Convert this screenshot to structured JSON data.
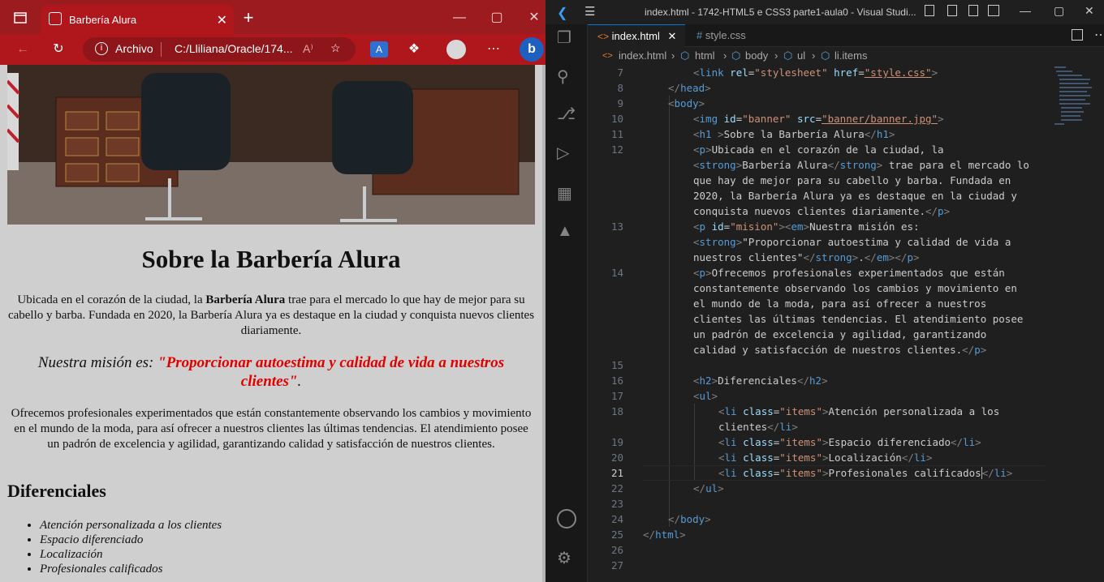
{
  "browser": {
    "tab_title": "Barbería Alura",
    "tab_close": "✕",
    "new_tab": "+",
    "window_controls": [
      "—",
      "▢",
      "✕"
    ],
    "address_label": "Archivo",
    "address_value": "C:/Lliliana/Oracle/174...",
    "reader": "A⁾",
    "icons": [
      "tabs-icon",
      "back-icon",
      "refresh-icon",
      "info-icon",
      "favorites-icon",
      "translate-icon",
      "extensions-icon",
      "profile-icon",
      "more-icon",
      "bing-icon"
    ]
  },
  "webpage": {
    "title": "Sobre la Barbería Alura",
    "intro_before": "Ubicada en el corazón de la ciudad, la ",
    "intro_strong": "Barbería Alura",
    "intro_after": " trae para el mercado lo que hay de mejor para su cabello y barba. Fundada en 2020, la Barbería Alura ya es destaque en la ciudad y conquista nuevos clientes diariamente.",
    "mision_label": "Nuestra misión es: ",
    "mision_quote": "\"Proporcionar autoestima y calidad de vida a nuestros clientes\"",
    "mision_end": ".",
    "paragraph2": "Ofrecemos profesionales experimentados que están constantemente observando los cambios y movimiento en el mundo de la moda, para así ofrecer a nuestros clientes las últimas tendencias. El atendimiento posee un padrón de excelencia y agilidad, garantizando calidad y satisfacción de nuestros clientes.",
    "h2": "Diferenciales",
    "items": [
      "Atención personalizada a los clientes",
      "Espacio diferenciado",
      "Localización",
      "Profesionales calificados"
    ]
  },
  "vscode": {
    "title": "index.html - 1742-HTML5 e CSS3 parte1-aula0 - Visual Studi...",
    "tabs": [
      {
        "label": "index.html",
        "close": "✕"
      },
      {
        "label": "style.css"
      }
    ],
    "breadcrumb": [
      "index.html",
      "html",
      "body",
      "ul",
      "li.items"
    ],
    "line_numbers": [
      "7",
      "8",
      "9",
      "10",
      "11",
      "12",
      "",
      "",
      "",
      "",
      "13",
      "",
      "",
      "14",
      "",
      "",
      "",
      "",
      "",
      "15",
      "16",
      "17",
      "18",
      "",
      "19",
      "20",
      "21",
      "22",
      "23",
      "24",
      "25",
      "26",
      "27"
    ],
    "active_line": "21"
  },
  "colors": {
    "browser_red": "#b0171d",
    "mision_red": "#e00000",
    "vs_bg": "#1f1f1f",
    "tag": "#569cd6",
    "attr": "#9cdcfe",
    "string": "#ce9178"
  }
}
